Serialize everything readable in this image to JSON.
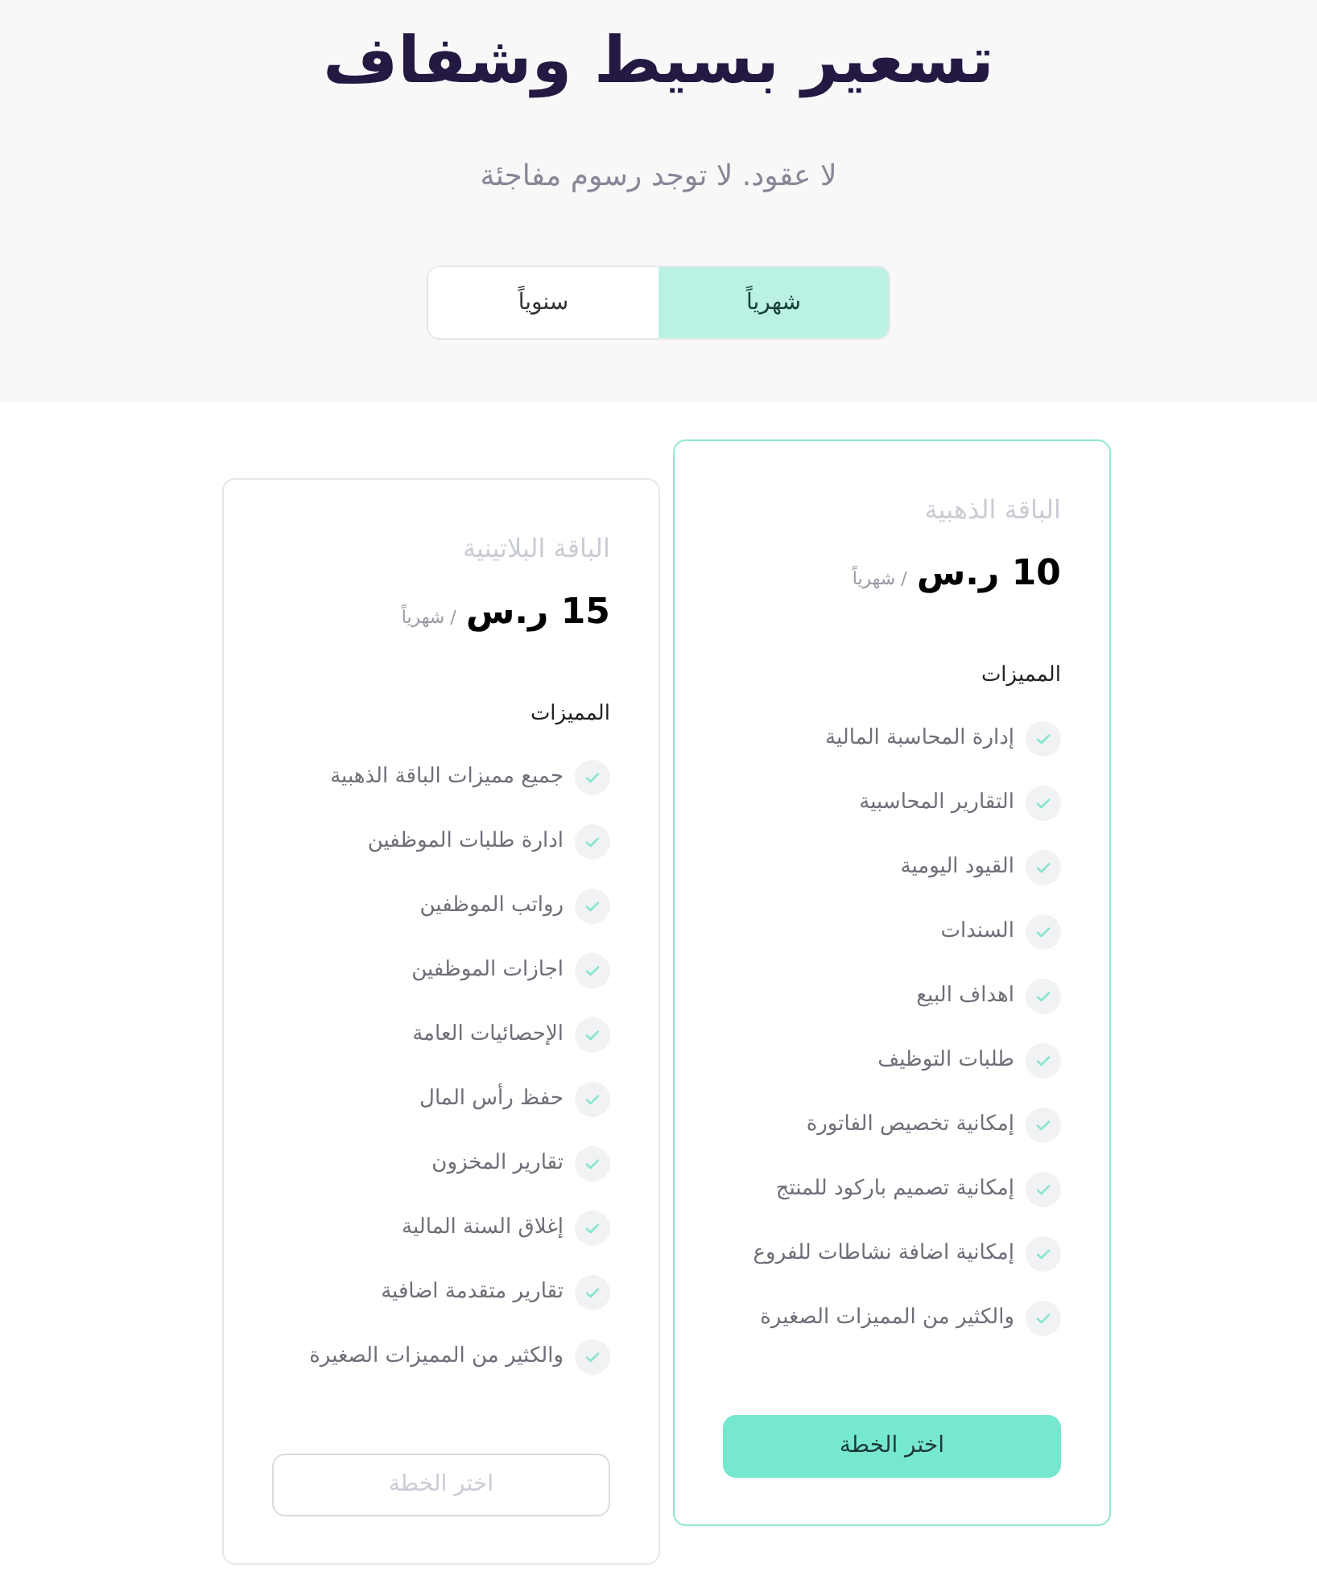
{
  "header": {
    "title": "تسعير بسيط وشفاف",
    "subtitle": "لا عقود. لا توجد رسوم مفاجئة"
  },
  "billing_toggle": [
    {
      "label": "شهرياً",
      "selected": true
    },
    {
      "label": "سنوياً",
      "selected": false
    }
  ],
  "plans": [
    {
      "name": "الباقة الذهبية",
      "price": "10 ر.س",
      "period": "/ شهرياً",
      "featured": true,
      "features_heading": "المميزات",
      "features": [
        "إدارة المحاسبة المالية",
        "التقارير المحاسبية",
        "القيود اليومية",
        "السندات",
        "اهداف البيع",
        "طلبات التوظيف",
        "إمكانية تخصيص الفاتورة",
        "إمكانية تصميم باركود للمنتج",
        "إمكانية اضافة نشاطات للفروع",
        "والكثير من المميزات الصغيرة"
      ],
      "button": "اختر الخطة"
    },
    {
      "name": "الباقة البلاتينية",
      "price": "15 ر.س",
      "period": "/ شهرياً",
      "featured": false,
      "features_heading": "المميزات",
      "features": [
        "جميع مميزات الباقة الذهبية",
        "ادارة طلبات الموظفين",
        "رواتب الموظفين",
        "اجازات الموظفين",
        "الإحصائيات العامة",
        "حفظ رأس المال",
        "تقارير المخزون",
        "إغلاق السنة المالية",
        "تقارير متقدمة اضافية",
        "والكثير من المميزات الصغيرة"
      ],
      "button": "اختر الخطة"
    }
  ]
}
